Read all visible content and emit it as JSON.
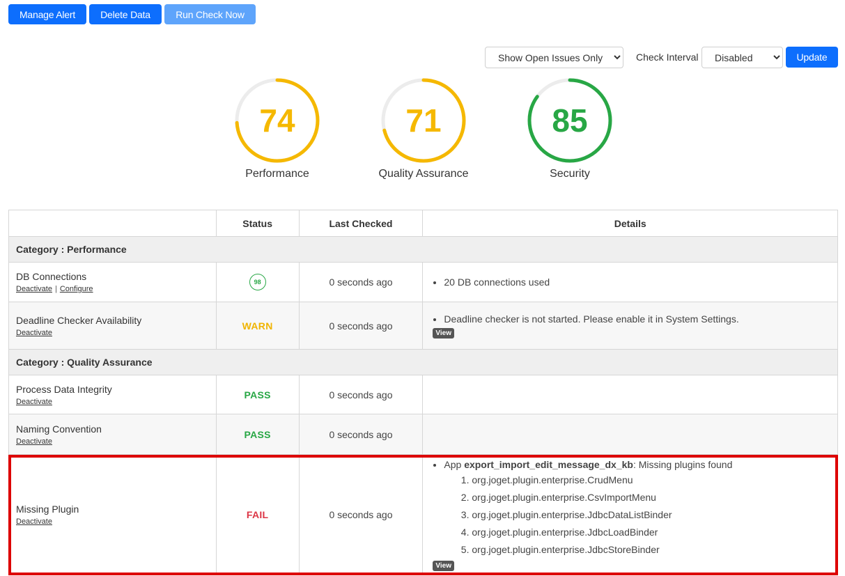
{
  "toolbar": {
    "manage_alert": "Manage Alert",
    "delete_data": "Delete Data",
    "run_check_now": "Run Check Now"
  },
  "filters": {
    "issue_filter": "Show Open Issues Only",
    "check_interval_label": "Check Interval",
    "check_interval_value": "Disabled",
    "update_label": "Update"
  },
  "scores": [
    {
      "label": "Performance",
      "value": 74,
      "color": "#f5b800"
    },
    {
      "label": "Quality Assurance",
      "value": 71,
      "color": "#f5b800"
    },
    {
      "label": "Security",
      "value": 85,
      "color": "#28a745"
    }
  ],
  "table": {
    "headers": [
      "",
      "Status",
      "Last Checked",
      "Details"
    ],
    "categories": [
      {
        "label": "Category : Performance"
      },
      {
        "label": "Category : Quality Assurance"
      }
    ],
    "rows": [
      {
        "name": "DB Connections",
        "action1": "Deactivate",
        "action2": "Configure",
        "status": "98",
        "last_checked": "0 seconds ago",
        "detail": "20 DB connections used"
      },
      {
        "name": "Deadline Checker Availability",
        "action1": "Deactivate",
        "status": "WARN",
        "last_checked": "0 seconds ago",
        "detail": "Deadline checker is not started. Please enable it in System Settings.",
        "view": "View"
      },
      {
        "name": "Process Data Integrity",
        "action1": "Deactivate",
        "status": "PASS",
        "last_checked": "0 seconds ago"
      },
      {
        "name": "Naming Convention",
        "action1": "Deactivate",
        "status": "PASS",
        "last_checked": "0 seconds ago"
      },
      {
        "name": "Missing Plugin",
        "action1": "Deactivate",
        "status": "FAIL",
        "last_checked": "0 seconds ago",
        "detail_prefix": "App ",
        "detail_app": "export_import_edit_message_dx_kb",
        "detail_suffix": ": Missing plugins found",
        "plugins": [
          "org.joget.plugin.enterprise.CrudMenu",
          "org.joget.plugin.enterprise.CsvImportMenu",
          "org.joget.plugin.enterprise.JdbcDataListBinder",
          "org.joget.plugin.enterprise.JdbcLoadBinder",
          "org.joget.plugin.enterprise.JdbcStoreBinder"
        ],
        "view": "View"
      }
    ]
  },
  "colors": {
    "primary": "#0d6efd",
    "warn": "#f0b400",
    "pass": "#28a745",
    "fail": "#dc3545",
    "highlight": "#dd0000"
  }
}
